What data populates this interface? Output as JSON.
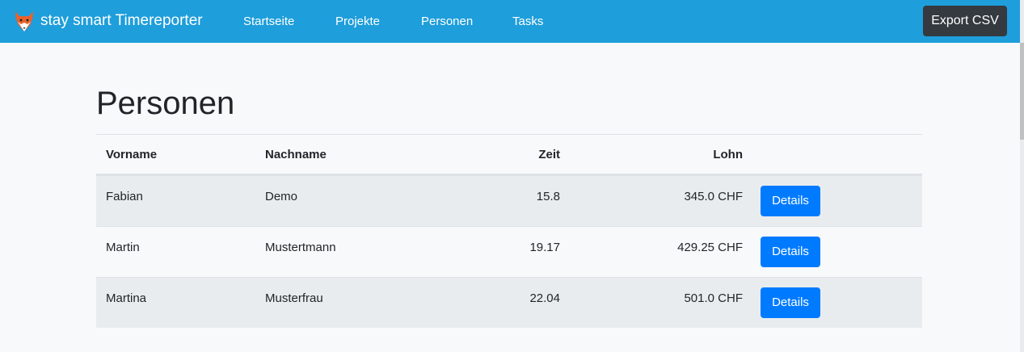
{
  "navbar": {
    "brand": "stay smart Timereporter",
    "links": [
      "Startseite",
      "Projekte",
      "Personen",
      "Tasks"
    ],
    "export_label": "Export CSV",
    "color": "#1e9edb"
  },
  "page": {
    "title": "Personen"
  },
  "table": {
    "headers": {
      "vorname": "Vorname",
      "nachname": "Nachname",
      "zeit": "Zeit",
      "lohn": "Lohn"
    },
    "rows": [
      {
        "vorname": "Fabian",
        "nachname": "Demo",
        "zeit": "15.8",
        "lohn": "345.0 CHF",
        "action": "Details"
      },
      {
        "vorname": "Martin",
        "nachname": "Mustertmann",
        "zeit": "19.17",
        "lohn": "429.25 CHF",
        "action": "Details"
      },
      {
        "vorname": "Martina",
        "nachname": "Musterfrau",
        "zeit": "22.04",
        "lohn": "501.0 CHF",
        "action": "Details"
      }
    ]
  },
  "icons": {
    "brand_logo": "fox-logo-icon"
  },
  "colors": {
    "primary_button": "#007bff",
    "dark_button": "#343a40"
  }
}
